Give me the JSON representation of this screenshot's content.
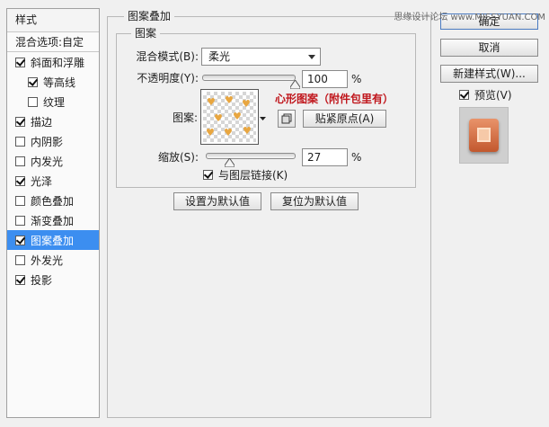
{
  "styles_panel": {
    "header": "样式",
    "blending_options": "混合选项:自定",
    "items": [
      {
        "label": "斜面和浮雕",
        "checked": true,
        "sub": false
      },
      {
        "label": "等高线",
        "checked": true,
        "sub": true
      },
      {
        "label": "纹理",
        "checked": false,
        "sub": true
      },
      {
        "label": "描边",
        "checked": true,
        "sub": false
      },
      {
        "label": "内阴影",
        "checked": false,
        "sub": false
      },
      {
        "label": "内发光",
        "checked": false,
        "sub": false
      },
      {
        "label": "光泽",
        "checked": true,
        "sub": false
      },
      {
        "label": "颜色叠加",
        "checked": false,
        "sub": false
      },
      {
        "label": "渐变叠加",
        "checked": false,
        "sub": false
      },
      {
        "label": "图案叠加",
        "checked": true,
        "sub": false,
        "selected": true
      },
      {
        "label": "外发光",
        "checked": false,
        "sub": false
      },
      {
        "label": "投影",
        "checked": true,
        "sub": false
      }
    ]
  },
  "pattern_overlay": {
    "group_title": "图案叠加",
    "subgroup_title": "图案",
    "blend_mode_label": "混合模式(B):",
    "blend_mode_value": "柔光",
    "opacity_label": "不透明度(Y):",
    "opacity_value": "100",
    "opacity_percent": 100,
    "percent_sign": "%",
    "pattern_label": "图案:",
    "snap_origin_button": "贴紧原点(A)",
    "scale_label": "缩放(S):",
    "scale_value": "27",
    "scale_percent": 27,
    "link_with_layer_label": "与图层链接(K)",
    "link_with_layer_checked": true,
    "set_default_button": "设置为默认值",
    "reset_default_button": "复位为默认值",
    "annotation": "心形图案（附件包里有）"
  },
  "side_buttons": {
    "ok": "确定",
    "cancel": "取消",
    "new_style": "新建样式(W)...",
    "preview_label": "预览(V)",
    "preview_checked": true
  },
  "watermark": "思缘设计论坛 www.MISSYUAN.COM",
  "colors": {
    "selection": "#3c8ef0",
    "annotation": "#c0161c",
    "heart": "#e8a640",
    "preview_accent": "#d2693c"
  }
}
